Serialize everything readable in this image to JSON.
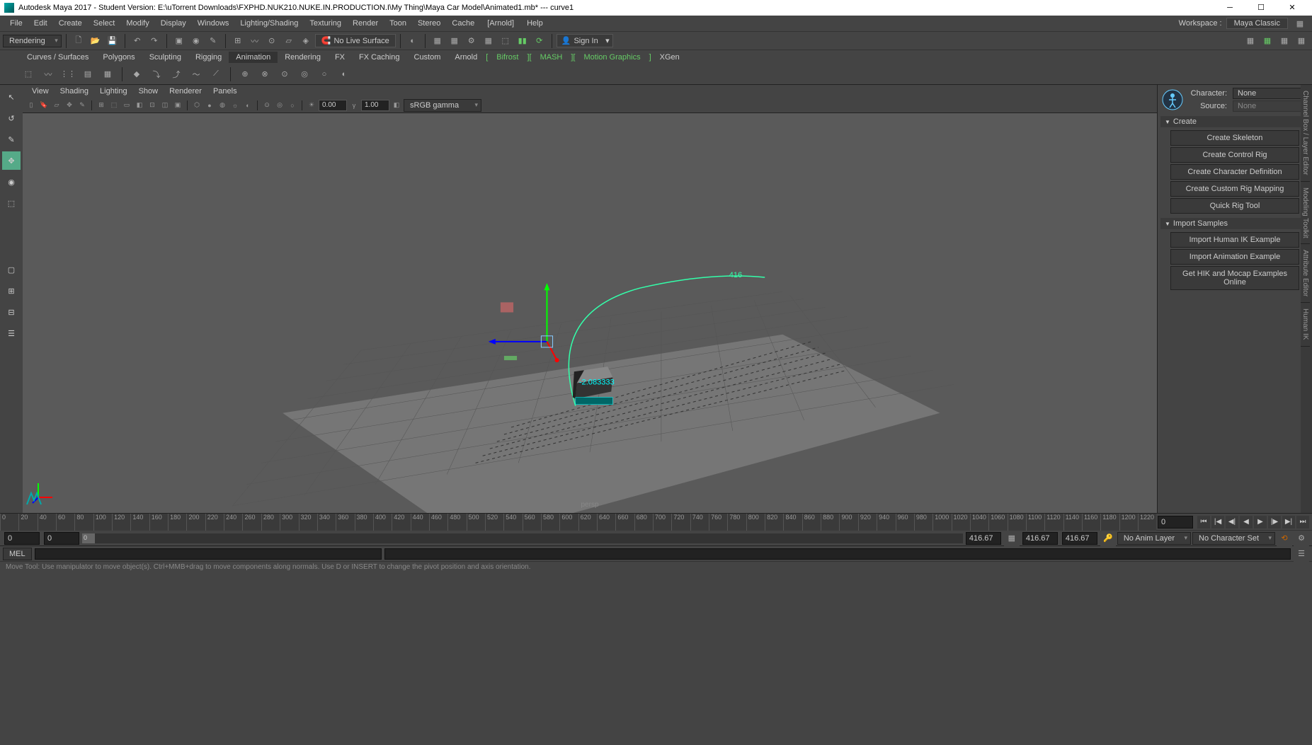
{
  "titlebar": {
    "app": "Autodesk Maya 2017 - Student Version: E:\\uTorrent Downloads\\FXPHD.NUK210.NUKE.IN.PRODUCTION.I\\My Thing\\Maya Car Model\\Animated1.mb*   ---   curve1"
  },
  "mainmenu": [
    "File",
    "Edit",
    "Create",
    "Select",
    "Modify",
    "Display",
    "Windows",
    "Lighting/Shading",
    "Texturing",
    "Render",
    "Toon",
    "Stereo",
    "Cache"
  ],
  "arnold": "[Arnold]",
  "help": "Help",
  "workspace_label": "Workspace :",
  "workspace_value": "Maya Classic",
  "moduleDropdown": "Rendering",
  "noLiveSurface": "No Live Surface",
  "signIn": "Sign In",
  "shelfTabs": [
    "Curves / Surfaces",
    "Polygons",
    "Sculpting",
    "Rigging",
    "Animation",
    "Rendering",
    "FX",
    "FX Caching",
    "Custom",
    "Arnold"
  ],
  "extraShelfTabs": [
    "Bifrost",
    "MASH",
    "Motion Graphics"
  ],
  "xgen": "XGen",
  "vpMenu": [
    "View",
    "Shading",
    "Lighting",
    "Show",
    "Renderer",
    "Panels"
  ],
  "vpNum1": "0.00",
  "vpNum2": "1.00",
  "vpColorspace": "sRGB gamma",
  "vpName": "persp",
  "vpAnnotation416": "416",
  "vpCoord": "-2.083333",
  "rightPanel": {
    "characterLabel": "Character:",
    "characterValue": "None",
    "sourceLabel": "Source:",
    "sourceValue": "None",
    "createHeader": "Create",
    "createButtons": [
      "Create Skeleton",
      "Create Control Rig",
      "Create Character Definition",
      "Create Custom Rig Mapping",
      "Quick Rig Tool"
    ],
    "importHeader": "Import Samples",
    "importButtons": [
      "Import Human IK Example",
      "Import Animation Example",
      "Get HIK and Mocap Examples Online"
    ]
  },
  "rightEdgeTabs": [
    "Channel Box / Layer Editor",
    "Modeling Toolkit",
    "Attribute Editor",
    "Human IK"
  ],
  "timeline": {
    "ticks": [
      "0",
      "20",
      "40",
      "60",
      "80",
      "100",
      "120",
      "140",
      "160",
      "180",
      "200",
      "220",
      "240",
      "260",
      "280",
      "300",
      "320",
      "340",
      "360",
      "380",
      "400",
      "420",
      "440",
      "460",
      "480",
      "500",
      "520",
      "540",
      "560",
      "580",
      "600",
      "620",
      "640",
      "660",
      "680",
      "700",
      "720",
      "740",
      "760",
      "780",
      "800",
      "820",
      "840",
      "860",
      "880",
      "900",
      "920",
      "940",
      "960",
      "980",
      "1000",
      "1020",
      "1040",
      "1060",
      "1080",
      "1100",
      "1120",
      "1140",
      "1160",
      "1180",
      "1200",
      "1220"
    ],
    "currentFrame": "0",
    "rangeStart": "0",
    "rangeStart2": "0",
    "rangeSlider": "0",
    "rangeEnd1": "416.67",
    "rangeEnd2": "416.67",
    "rangeEnd3": "416.67",
    "noAnimLayer": "No Anim Layer",
    "noCharSet": "No Character Set"
  },
  "cmd": {
    "label": "MEL"
  },
  "helpLine": "Move Tool: Use manipulator to move object(s). Ctrl+MMB+drag to move components along normals. Use D or INSERT to change the pivot position and axis orientation."
}
